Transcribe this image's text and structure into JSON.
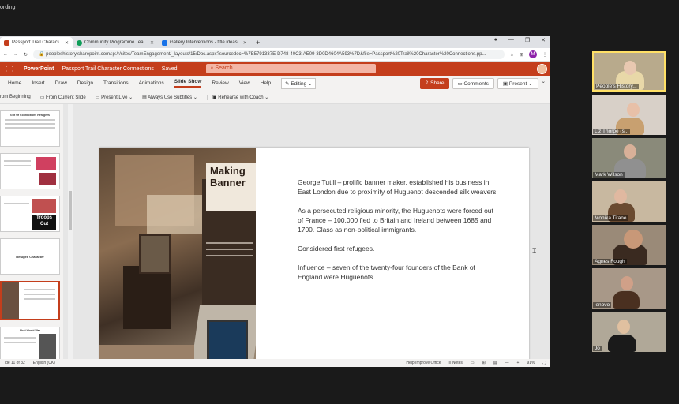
{
  "recording_label": "ording",
  "browser": {
    "tabs": [
      {
        "label": "Passport Trail Character Connec",
        "color": "#c43e1c"
      },
      {
        "label": "Community Programme Team D",
        "color": "#0f9d58"
      },
      {
        "label": "Gallery Interventions - title ideas",
        "color": "#1a73e8"
      }
    ],
    "new_tab": "+",
    "window_controls": [
      "●",
      "—",
      "❐",
      "✕"
    ],
    "url": "peopleshistory.sharepoint.com/:p:/r/sites/TeamEngagement/_layouts/15/Doc.aspx?sourcedoc=%7B5791337E-D748-40C3-AE09-3D0D4604A593%7D&file=Passport%20Trail%20Character%20Connections.pp...",
    "profile_initial": "M"
  },
  "ppt": {
    "app_name": "PowerPoint",
    "doc_title": "Passport Trail Character Connections",
    "saved_status": "– Saved",
    "search_placeholder": "Search",
    "ribbon_tabs": [
      "Home",
      "Insert",
      "Draw",
      "Design",
      "Transitions",
      "Animations",
      "Slide Show",
      "Review",
      "View",
      "Help"
    ],
    "selected_tab": "Slide Show",
    "editing_label": "Editing",
    "share_label": "Share",
    "comments_label": "Comments",
    "present_label": "Present",
    "commands": [
      "rom Beginning",
      "From Current Slide",
      "Present Live",
      "Always Use Subtitles",
      "Rehearse with Coach"
    ]
  },
  "thumbnails": [
    {
      "title": "Grit Of Connections Refugees"
    },
    {
      "title": ""
    },
    {
      "title": "Troops Out"
    },
    {
      "title": "Refugee Character"
    },
    {
      "title": ""
    },
    {
      "title": "First World War"
    }
  ],
  "slide": {
    "image_title": "Making Banner",
    "paragraphs": [
      "George Tutill – prolific banner maker, established his business in East London due to proximity of Huguenot descended silk weavers.",
      "As a persecuted religious minority, the Huguenots were forced out of France – 100,000 fled to Britain and Ireland between 1685 and 1700.  Class as non-political immigrants.",
      "Considered first refugees.",
      "Influence – seven of the twenty-four founders of the Bank of England were Huguenots."
    ]
  },
  "status_bar": {
    "slide_count": "ide 11 of 32",
    "language": "English (UK)",
    "help": "Help Improve Office",
    "notes": "Notes",
    "zoom": "91%"
  },
  "participants": [
    {
      "name": "People's History...",
      "bg": "#b8aa8c",
      "skin": "#e8c8b0",
      "hair": "#e8d8a8",
      "active": true
    },
    {
      "name": "Liz Thorpe (s...",
      "bg": "#d8d0c8",
      "skin": "#e8c0a8",
      "hair": "#c8a070",
      "active": false
    },
    {
      "name": "Mark Wilson",
      "bg": "#8a8a7a",
      "skin": "#d8b098",
      "hair": "#909090",
      "active": false
    },
    {
      "name": "Monika Titane",
      "bg": "#c8b8a0",
      "skin": "#e0b8a0",
      "hair": "#6a4a30",
      "active": false
    },
    {
      "name": "Agnes Fough",
      "bg": "#9a8a78",
      "skin": "#c89878",
      "hair": "#3a2a20",
      "active": false
    },
    {
      "name": "lenovo",
      "bg": "#a89888",
      "skin": "#d0a088",
      "hair": "#4a3020",
      "active": false
    },
    {
      "name": "Jo",
      "bg": "#b0a898",
      "skin": "#e0c0a0",
      "hair": "#1a1a1a",
      "active": false
    }
  ]
}
